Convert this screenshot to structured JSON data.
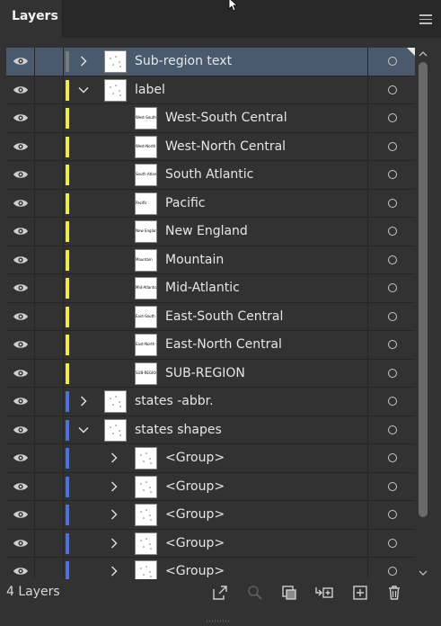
{
  "panel": {
    "tab_label": "Layers",
    "layer_count_label": "4 Layers"
  },
  "colors": {
    "selection": "#4a5a6e",
    "gray_layer": "#7a7a7a",
    "yellow_layer": "#f4ec3c",
    "blue_layer": "#4a73e0"
  },
  "rows": [
    {
      "name": "Sub-region text",
      "level": 0,
      "expanded": false,
      "color": "gray",
      "selected": true,
      "thumb_text": ""
    },
    {
      "name": "label",
      "level": 0,
      "expanded": true,
      "color": "yellow",
      "selected": false,
      "thumb_text": ""
    },
    {
      "name": "West-South Central",
      "level": 1,
      "expanded": null,
      "color": "yellow",
      "selected": false,
      "thumb_text": "West-South Central"
    },
    {
      "name": "West-North Central",
      "level": 1,
      "expanded": null,
      "color": "yellow",
      "selected": false,
      "thumb_text": "West-North Central"
    },
    {
      "name": "South Atlantic",
      "level": 1,
      "expanded": null,
      "color": "yellow",
      "selected": false,
      "thumb_text": "South Atlantic"
    },
    {
      "name": "Pacific",
      "level": 1,
      "expanded": null,
      "color": "yellow",
      "selected": false,
      "thumb_text": "Pacific"
    },
    {
      "name": "New England",
      "level": 1,
      "expanded": null,
      "color": "yellow",
      "selected": false,
      "thumb_text": "New England"
    },
    {
      "name": "Mountain",
      "level": 1,
      "expanded": null,
      "color": "yellow",
      "selected": false,
      "thumb_text": "Mountain"
    },
    {
      "name": "Mid-Atlantic",
      "level": 1,
      "expanded": null,
      "color": "yellow",
      "selected": false,
      "thumb_text": "Mid-Atlantic"
    },
    {
      "name": "East-South Central",
      "level": 1,
      "expanded": null,
      "color": "yellow",
      "selected": false,
      "thumb_text": "East-South Central"
    },
    {
      "name": "East-North Central",
      "level": 1,
      "expanded": null,
      "color": "yellow",
      "selected": false,
      "thumb_text": "East-North Central"
    },
    {
      "name": "SUB-REGION",
      "level": 1,
      "expanded": null,
      "color": "yellow",
      "selected": false,
      "thumb_text": "SUB-REGION"
    },
    {
      "name": "states -abbr.",
      "level": 0,
      "expanded": false,
      "color": "blue",
      "selected": false,
      "thumb_text": ""
    },
    {
      "name": "states shapes",
      "level": 0,
      "expanded": true,
      "color": "blue",
      "selected": false,
      "thumb_text": ""
    },
    {
      "name": "<Group>",
      "level": 1,
      "expanded": false,
      "color": "blue",
      "selected": false,
      "thumb_text": ""
    },
    {
      "name": "<Group>",
      "level": 1,
      "expanded": false,
      "color": "blue",
      "selected": false,
      "thumb_text": ""
    },
    {
      "name": "<Group>",
      "level": 1,
      "expanded": false,
      "color": "blue",
      "selected": false,
      "thumb_text": ""
    },
    {
      "name": "<Group>",
      "level": 1,
      "expanded": false,
      "color": "blue",
      "selected": false,
      "thumb_text": ""
    },
    {
      "name": "<Group>",
      "level": 1,
      "expanded": false,
      "color": "blue",
      "selected": false,
      "thumb_text": ""
    }
  ],
  "bottom_icons": [
    "export-icon",
    "locate-object-icon",
    "make-clipping-mask-icon",
    "create-sublayer-icon",
    "new-layer-icon",
    "delete-icon"
  ]
}
